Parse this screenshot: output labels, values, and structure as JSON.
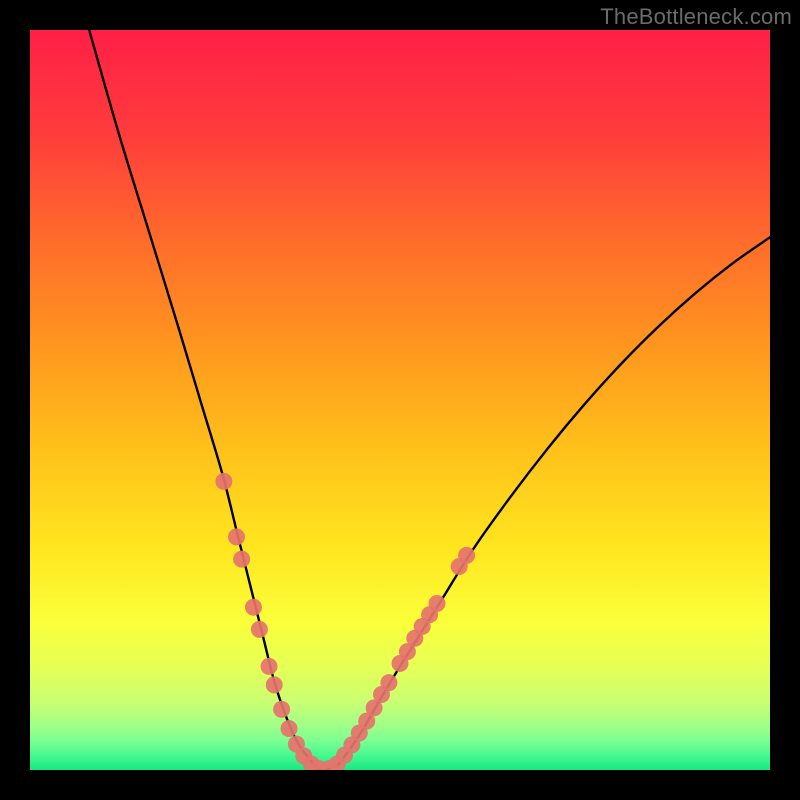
{
  "watermark": "TheBottleneck.com",
  "chart_data": {
    "type": "line",
    "title": "",
    "xlabel": "",
    "ylabel": "",
    "xlim": [
      0,
      100
    ],
    "ylim": [
      0,
      100
    ],
    "grid": false,
    "legend": false,
    "annotations": [],
    "series": [
      {
        "name": "curve",
        "x": [
          8,
          12,
          16,
          20,
          23,
          26,
          28,
          30,
          31.5,
          33,
          34.5,
          36,
          37.5,
          38.5,
          39,
          40,
          41.5,
          43,
          45,
          47,
          50,
          55,
          60,
          65,
          70,
          75,
          80,
          85,
          90,
          95,
          100
        ],
        "values": [
          100,
          86,
          73,
          60,
          50,
          40,
          32,
          24,
          18,
          12,
          7.5,
          4,
          1.8,
          0.6,
          0,
          0,
          0.6,
          2.5,
          5.5,
          9,
          14,
          22,
          30,
          37,
          43.5,
          49.5,
          55,
          60,
          64.5,
          68.5,
          72
        ]
      }
    ],
    "marker_clusters": [
      {
        "name": "left-cluster",
        "color": "#e5736c",
        "points": [
          {
            "x": 26.2,
            "y": 39.0
          },
          {
            "x": 27.9,
            "y": 31.5
          },
          {
            "x": 28.6,
            "y": 28.5
          },
          {
            "x": 30.2,
            "y": 22.0
          },
          {
            "x": 31.0,
            "y": 19.0
          },
          {
            "x": 32.3,
            "y": 14.0
          },
          {
            "x": 33.0,
            "y": 11.5
          },
          {
            "x": 34.0,
            "y": 8.2
          },
          {
            "x": 35.0,
            "y": 5.6
          },
          {
            "x": 36.0,
            "y": 3.5
          },
          {
            "x": 37.0,
            "y": 1.9
          },
          {
            "x": 38.0,
            "y": 0.8
          },
          {
            "x": 39.0,
            "y": 0.2
          }
        ]
      },
      {
        "name": "right-cluster",
        "color": "#e5736c",
        "points": [
          {
            "x": 40.5,
            "y": 0.2
          },
          {
            "x": 41.5,
            "y": 0.8
          },
          {
            "x": 42.5,
            "y": 2.0
          },
          {
            "x": 43.5,
            "y": 3.4
          },
          {
            "x": 44.5,
            "y": 5.0
          },
          {
            "x": 45.5,
            "y": 6.6
          },
          {
            "x": 46.5,
            "y": 8.4
          },
          {
            "x": 47.5,
            "y": 10.2
          },
          {
            "x": 48.5,
            "y": 11.8
          },
          {
            "x": 50.0,
            "y": 14.4
          },
          {
            "x": 51.0,
            "y": 16.0
          },
          {
            "x": 52.0,
            "y": 17.8
          },
          {
            "x": 53.0,
            "y": 19.4
          },
          {
            "x": 54.0,
            "y": 21.0
          },
          {
            "x": 55.0,
            "y": 22.5
          },
          {
            "x": 58.0,
            "y": 27.5
          },
          {
            "x": 59.0,
            "y": 29.0
          }
        ]
      }
    ],
    "background_gradient": {
      "stops": [
        {
          "offset": 0.0,
          "color": "#ff1f47"
        },
        {
          "offset": 0.14,
          "color": "#ff3c3c"
        },
        {
          "offset": 0.28,
          "color": "#ff6a2c"
        },
        {
          "offset": 0.42,
          "color": "#ff941f"
        },
        {
          "offset": 0.56,
          "color": "#ffbf1a"
        },
        {
          "offset": 0.7,
          "color": "#ffe61f"
        },
        {
          "offset": 0.8,
          "color": "#faff3a"
        },
        {
          "offset": 0.86,
          "color": "#e6ff55"
        },
        {
          "offset": 0.905,
          "color": "#ccff70"
        },
        {
          "offset": 0.935,
          "color": "#a8ff85"
        },
        {
          "offset": 0.96,
          "color": "#7cff92"
        },
        {
          "offset": 0.98,
          "color": "#46f98f"
        },
        {
          "offset": 1.0,
          "color": "#18e884"
        }
      ]
    }
  }
}
